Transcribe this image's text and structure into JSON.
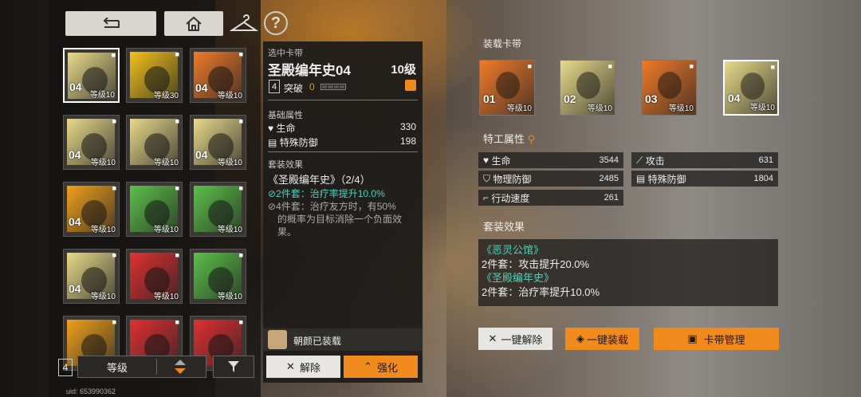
{
  "nav": {
    "back_icon": "back-arrow-icon",
    "home_icon": "home-icon",
    "wardrobe_icon": "hanger-icon",
    "help_label": "?"
  },
  "inventory": {
    "cards": [
      {
        "code": "04",
        "level": "等级10",
        "locked": true,
        "selected": true,
        "color": "#e9d98a"
      },
      {
        "code": "",
        "level": "等级30",
        "locked": true,
        "selected": false,
        "color": "#f2c21c"
      },
      {
        "code": "04",
        "level": "等级10",
        "locked": true,
        "selected": false,
        "color": "#f07a2a"
      },
      {
        "code": "04",
        "level": "等级10",
        "locked": true,
        "selected": false,
        "color": "#e9d98a"
      },
      {
        "code": "",
        "level": "等级10",
        "locked": true,
        "selected": false,
        "color": "#e9d98a"
      },
      {
        "code": "04",
        "level": "等级10",
        "locked": true,
        "selected": false,
        "color": "#e9d98a"
      },
      {
        "code": "04",
        "level": "等级10",
        "locked": true,
        "selected": false,
        "color": "#f0a01c"
      },
      {
        "code": "",
        "level": "等级10",
        "locked": true,
        "selected": false,
        "color": "#5cc04a"
      },
      {
        "code": "",
        "level": "等级10",
        "locked": true,
        "selected": false,
        "color": "#5cc04a"
      },
      {
        "code": "04",
        "level": "等级10",
        "locked": true,
        "selected": false,
        "color": "#e9d98a"
      },
      {
        "code": "",
        "level": "等级10",
        "locked": true,
        "selected": false,
        "color": "#e03030"
      },
      {
        "code": "",
        "level": "等级10",
        "locked": true,
        "selected": false,
        "color": "#5cc04a"
      },
      {
        "code": "",
        "level": "",
        "locked": true,
        "selected": false,
        "color": "#f0a01c"
      },
      {
        "code": "",
        "level": "",
        "locked": true,
        "selected": false,
        "color": "#e03030"
      },
      {
        "code": "",
        "level": "",
        "locked": true,
        "selected": false,
        "color": "#e03030"
      }
    ],
    "count_badge": "4",
    "sort_label": "等级",
    "filter_icon": "filter-icon"
  },
  "detail": {
    "section_label": "选中卡带",
    "name": "圣殿编年史04",
    "level": "10级",
    "slot": "4",
    "breakthrough_label": "突破",
    "breakthrough_value": "0",
    "base_attr_title": "基础属性",
    "base_attrs": [
      {
        "name": "生命",
        "value": "330"
      },
      {
        "name": "特殊防御",
        "value": "198"
      }
    ],
    "set_title": "套装效果",
    "set_name": "《圣殿编年史》",
    "set_progress": "（2/4）",
    "set_2": "2件套：治疗率提升10.0%",
    "set_4_line1": "4件套：治疗友方时，有50%",
    "set_4_line2": "的概率为目标消除一个负面效",
    "set_4_line3": "果。",
    "equipped_by": "朝颜已装载",
    "remove_label": "解除",
    "enhance_label": "强化"
  },
  "loadout": {
    "title": "装载卡带",
    "slots": [
      {
        "code": "01",
        "level": "等级10",
        "color": "#f07a2a",
        "selected": false
      },
      {
        "code": "02",
        "level": "等级10",
        "color": "#e9d98a",
        "selected": false
      },
      {
        "code": "03",
        "level": "等级10",
        "color": "#f07a2a",
        "selected": false
      },
      {
        "code": "04",
        "level": "等级10",
        "color": "#e9d98a",
        "selected": true
      }
    ],
    "agent_attr_title": "特工属性",
    "stats": [
      {
        "name": "生命",
        "value": "3544",
        "icon": "heart-icon"
      },
      {
        "name": "攻击",
        "value": "631",
        "icon": "sword-icon"
      },
      {
        "name": "物理防御",
        "value": "2485",
        "icon": "shield-icon"
      },
      {
        "name": "特殊防御",
        "value": "1804",
        "icon": "stripe-shield-icon"
      },
      {
        "name": "行动速度",
        "value": "261",
        "icon": "boot-icon"
      }
    ],
    "set_title": "套装效果",
    "sets": [
      {
        "name": "《恶灵公馆》",
        "effect": "2件套：攻击提升20.0%"
      },
      {
        "name": "《圣殿编年史》",
        "effect": "2件套：治疗率提升10.0%"
      }
    ],
    "unequip_all": "一键解除",
    "equip_all": "一键装载",
    "manage": "卡带管理"
  },
  "uid": "uid: 653990362"
}
